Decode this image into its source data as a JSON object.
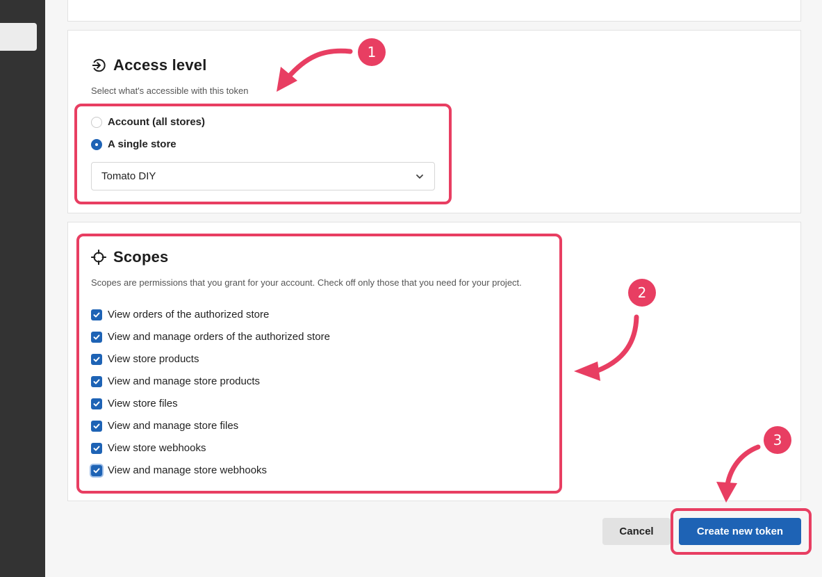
{
  "access": {
    "title": "Access level",
    "description": "Select what's accessible with this token",
    "options": [
      {
        "label": "Account (all stores)",
        "checked": false
      },
      {
        "label": "A single store",
        "checked": true
      }
    ],
    "store_select": {
      "value": "Tomato DIY"
    }
  },
  "scopes": {
    "title": "Scopes",
    "description": "Scopes are permissions that you grant for your account. Check off only those that you need for your project.",
    "items": [
      {
        "label": "View orders of the authorized store",
        "checked": true
      },
      {
        "label": "View and manage orders of the authorized store",
        "checked": true
      },
      {
        "label": "View store products",
        "checked": true
      },
      {
        "label": "View and manage store products",
        "checked": true
      },
      {
        "label": "View store files",
        "checked": true
      },
      {
        "label": "View and manage store files",
        "checked": true
      },
      {
        "label": "View store webhooks",
        "checked": true
      },
      {
        "label": "View and manage store webhooks",
        "checked": true
      }
    ]
  },
  "actions": {
    "cancel_label": "Cancel",
    "create_label": "Create new token"
  },
  "annotations": {
    "badges": [
      "1",
      "2",
      "3"
    ],
    "color": "#e83e62"
  },
  "colors": {
    "primary": "#1e63b5",
    "sidebar": "#333333"
  }
}
